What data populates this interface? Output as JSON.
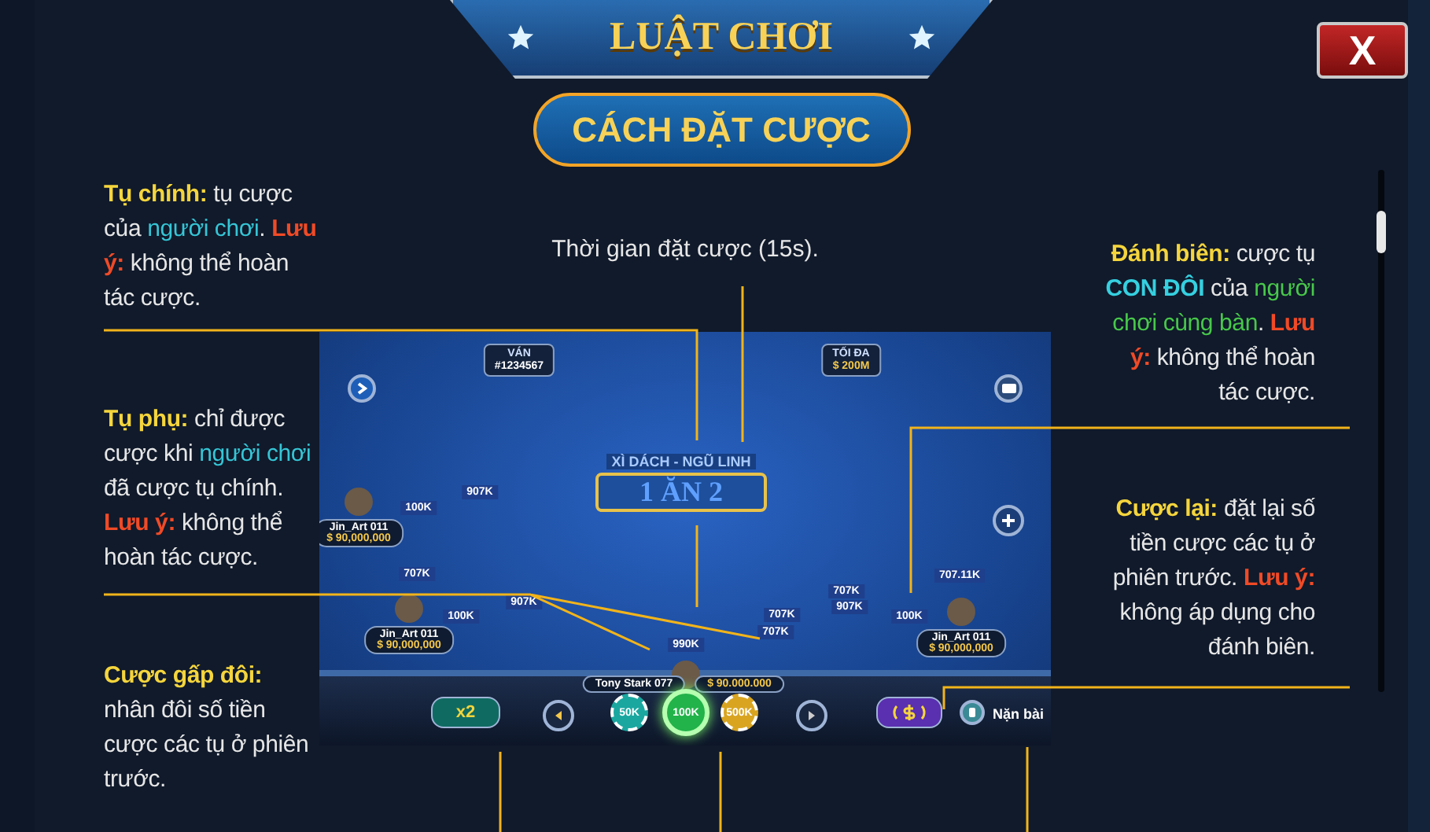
{
  "dialog": {
    "title": "LUẬT CHƠI",
    "close_label": "X",
    "section_title": "CÁCH ĐẶT CƯỢC"
  },
  "caption": "Thời gian đặt cược (15s).",
  "notes_left": [
    {
      "parts": [
        {
          "kind": "label",
          "text": "Tụ chính:"
        },
        {
          "kind": "plain",
          "text": " tụ cược của "
        },
        {
          "kind": "player",
          "text": "người chơi"
        },
        {
          "kind": "plain",
          "text": ". "
        },
        {
          "kind": "warning",
          "text": "Lưu ý:"
        },
        {
          "kind": "plain",
          "text": " không thể hoàn tác cược."
        }
      ]
    },
    {
      "parts": [
        {
          "kind": "label",
          "text": "Tụ phụ:"
        },
        {
          "kind": "plain",
          "text": " chỉ được cược khi "
        },
        {
          "kind": "player",
          "text": "người chơi"
        },
        {
          "kind": "plain",
          "text": " đã cược tụ chính. "
        },
        {
          "kind": "warning",
          "text": "Lưu ý:"
        },
        {
          "kind": "plain",
          "text": " không thể hoàn tác cược."
        }
      ]
    },
    {
      "parts": [
        {
          "kind": "label",
          "text": "Cược gấp đôi:"
        },
        {
          "kind": "plain",
          "text": " nhân đôi số tiền cược các tụ ở phiên trước."
        }
      ]
    }
  ],
  "notes_right": [
    {
      "parts": [
        {
          "kind": "label",
          "text": "Đánh biên:"
        },
        {
          "kind": "plain",
          "text": " cược tụ "
        },
        {
          "kind": "highlight",
          "text": "CON ĐÔI"
        },
        {
          "kind": "plain",
          "text": " của "
        },
        {
          "kind": "table",
          "text": "người chơi cùng bàn"
        },
        {
          "kind": "plain",
          "text": ". "
        },
        {
          "kind": "warning",
          "text": "Lưu ý:"
        },
        {
          "kind": "plain",
          "text": " không thể hoàn tác cược."
        }
      ]
    },
    {
      "parts": [
        {
          "kind": "label",
          "text": "Cược lại:"
        },
        {
          "kind": "plain",
          "text": " đặt lại số tiền cược các tụ ở phiên trước. "
        },
        {
          "kind": "warning",
          "text": "Lưu ý:"
        },
        {
          "kind": "plain",
          "text": " không áp dụng cho đánh biên."
        }
      ]
    }
  ],
  "game": {
    "round_label": "VÁN",
    "round_id": "#1234567",
    "max_label": "TỐI ĐA",
    "max_value": "$ 200M",
    "banner_subtitle": "XÌ DÁCH - NGŨ LINH",
    "banner_title": "1 ĂN 2",
    "players": [
      {
        "name": "Jin_Art 011",
        "balance": "$ 90,000,000"
      },
      {
        "name": "Jin_Art 011",
        "balance": "$ 90,000,000"
      },
      {
        "name": "Jin_Art 011",
        "balance": "$ 90,000,000"
      }
    ],
    "bets": [
      "907K",
      "100K",
      "707K",
      "907K",
      "100K",
      "990K",
      "707K",
      "707K",
      "707K",
      "907K",
      "100K",
      "707.11K"
    ],
    "me": {
      "name": "Tony Stark 077",
      "balance": "$ 90.000.000"
    },
    "double_label": "x2",
    "chips": [
      {
        "label": "50K",
        "color": "#1aa7a0",
        "selected": false
      },
      {
        "label": "100K",
        "color": "#22b34a",
        "selected": true
      },
      {
        "label": "500K",
        "color": "#d9a521",
        "selected": false
      }
    ],
    "peek_label": "Nặn bài"
  }
}
